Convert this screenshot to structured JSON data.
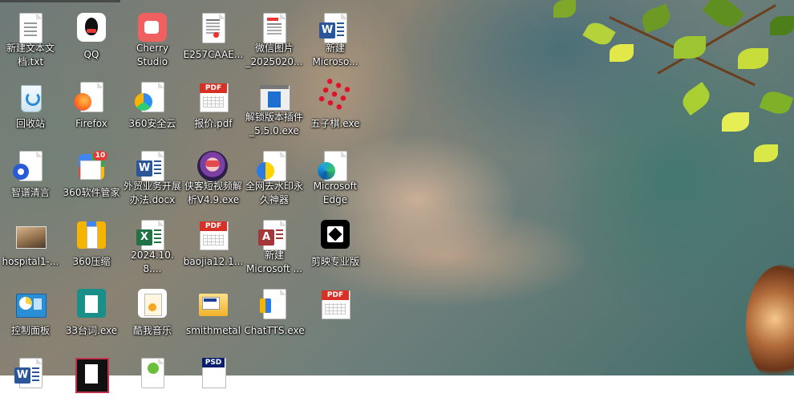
{
  "desktop": {
    "icons": [
      {
        "label": "新建文本文\n档.txt",
        "icon": "text-file-icon"
      },
      {
        "label": "QQ",
        "icon": "qq-icon"
      },
      {
        "label": "Cherry\nStudio",
        "icon": "cherry-studio-icon"
      },
      {
        "label": "E257CAAE...",
        "icon": "document-file-icon"
      },
      {
        "label": "微信图片\n_2025020...",
        "icon": "image-file-icon"
      },
      {
        "label": "新建\nMicroso...",
        "icon": "word-doc-icon"
      },
      {
        "label": "回收站",
        "icon": "recycle-bin-icon"
      },
      {
        "label": "Firefox",
        "icon": "firefox-icon"
      },
      {
        "label": "360安全云",
        "icon": "360-security-cloud-icon"
      },
      {
        "label": "报价.pdf",
        "icon": "pdf-file-icon"
      },
      {
        "label": "解锁版本插件\n_5.5.0.exe",
        "icon": "exe-window-icon"
      },
      {
        "label": "五子棋.exe",
        "icon": "gomoku-icon"
      },
      {
        "label": "智谱清言",
        "icon": "zhipu-icon"
      },
      {
        "label": "360软件管家",
        "icon": "360-software-manager-icon"
      },
      {
        "label": "外贸业务开展\n办法.docx",
        "icon": "word-doc-icon"
      },
      {
        "label": "侠客短视频解\n析V4.9.exe",
        "icon": "xiake-video-icon"
      },
      {
        "label": "全网去水印永\n久神器",
        "icon": "watermark-remover-icon"
      },
      {
        "label": "Microsoft\nEdge",
        "icon": "edge-icon"
      },
      {
        "label": "hospital1-...",
        "icon": "image-thumbnail-icon"
      },
      {
        "label": "360压缩",
        "icon": "360-zip-icon"
      },
      {
        "label": "2024.10.8....",
        "icon": "excel-file-icon"
      },
      {
        "label": "baojia12.1...",
        "icon": "pdf-file-icon"
      },
      {
        "label": "新建\nMicrosoft ...",
        "icon": "access-file-icon"
      },
      {
        "label": "剪映专业版",
        "icon": "capcut-icon"
      },
      {
        "label": "控制面板",
        "icon": "control-panel-icon"
      },
      {
        "label": "33台词.exe",
        "icon": "exe-app-icon"
      },
      {
        "label": "酷我音乐",
        "icon": "kuwo-music-icon"
      },
      {
        "label": "smithmetal",
        "icon": "folder-shortcut-icon"
      },
      {
        "label": "ChatTTS.exe",
        "icon": "chattts-icon"
      },
      {
        "label": "",
        "icon": "pdf-file-icon"
      },
      {
        "label": "",
        "icon": "word-doc-icon"
      },
      {
        "label": "",
        "icon": "selected-file-icon"
      },
      {
        "label": "",
        "icon": "green-shortcut-icon"
      },
      {
        "label": "",
        "icon": "psd-file-icon"
      }
    ]
  },
  "badges": {
    "pdf": "PDF",
    "word": "W",
    "excel": "X",
    "access": "A",
    "psd": "PSD",
    "count": "10"
  },
  "colors": {
    "word": "#2b579a",
    "excel": "#217346",
    "pdf": "#d93025",
    "access": "#a4373a",
    "accent": "#0078d7"
  }
}
